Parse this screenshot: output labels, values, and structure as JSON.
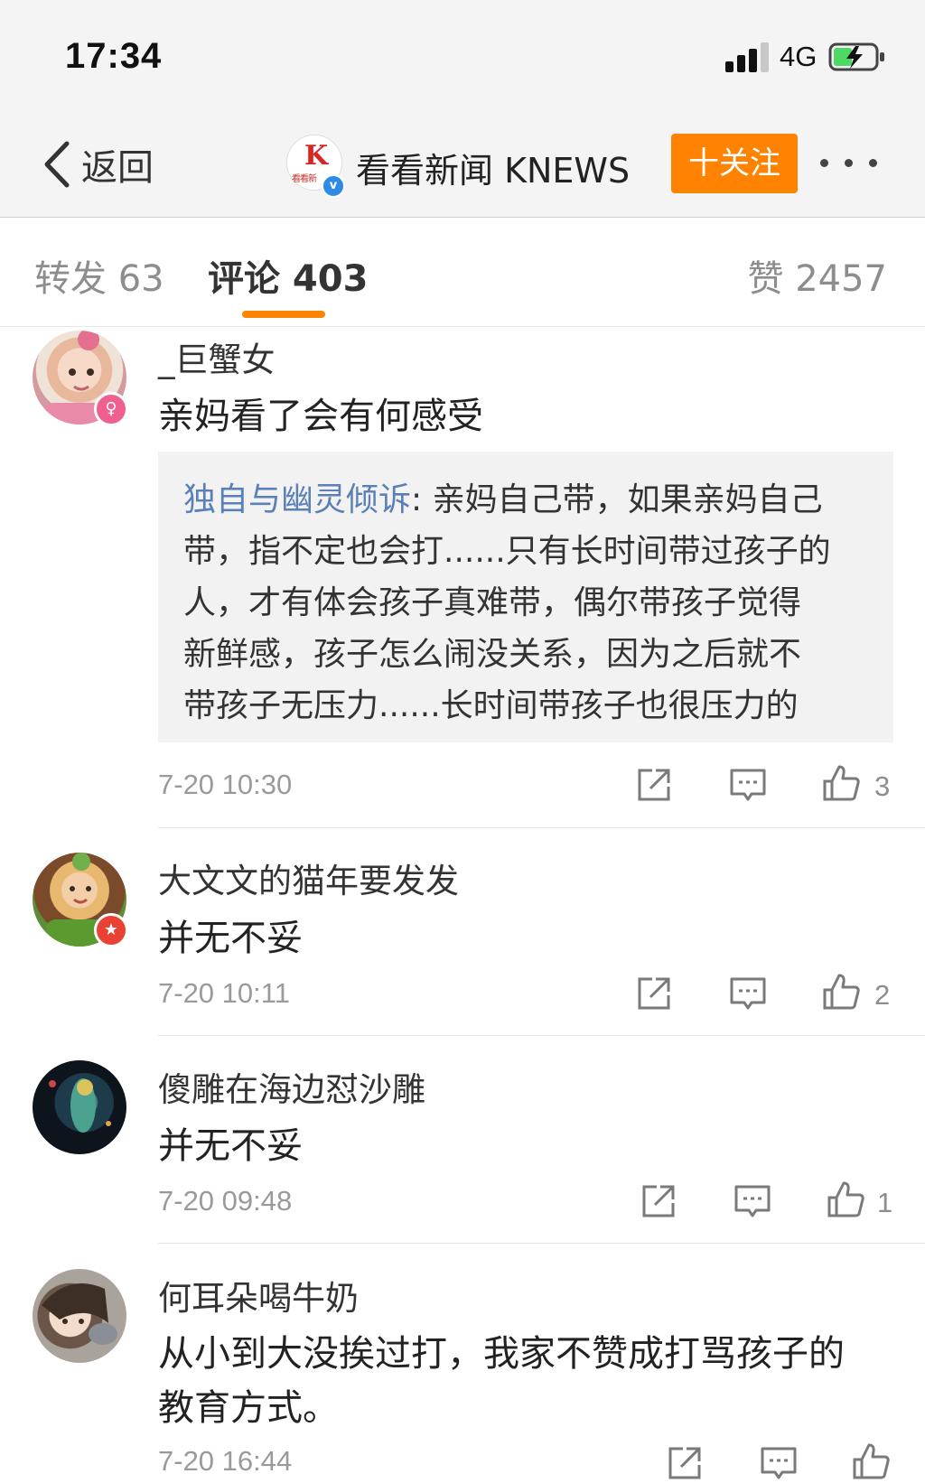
{
  "status": {
    "time": "17:34",
    "network": "4G"
  },
  "header": {
    "back_label": "返回",
    "account_name": "看看新闻 KNEWS",
    "logo_letter": "K",
    "logo_sub": "看看新",
    "verified_mark": "v",
    "follow_label": "十关注"
  },
  "tabs": {
    "repost": "转发 63",
    "comment": "评论 403",
    "like": "赞 2457"
  },
  "comments": [
    {
      "user": "_巨蟹女",
      "lines": [
        "亲妈看了会有何感受"
      ],
      "reply": {
        "user": "独自与幽灵倾诉",
        "lines": [
          ": 亲妈自己带，如果亲妈自己",
          "带，指不定也会打......只有长时间带过孩子的",
          "人，才有体会孩子真难带，偶尔带孩子觉得",
          "新鲜感，孩子怎么闹没关系，因为之后就不",
          "带孩子无压力......长时间带孩子也很压力的"
        ]
      },
      "time": "7-20 10:30",
      "likes": "3"
    },
    {
      "user": "大文文的猫年要发发",
      "lines": [
        "并无不妥"
      ],
      "time": "7-20 10:11",
      "likes": "2"
    },
    {
      "user": "傻雕在海边怼沙雕",
      "lines": [
        "并无不妥"
      ],
      "time": "7-20 09:48",
      "likes": "1"
    },
    {
      "user": "何耳朵喝牛奶",
      "lines": [
        "从小到大没挨过打，我家不赞成打骂孩子的",
        "教育方式。"
      ],
      "time": "7-20 16:44",
      "likes": ""
    }
  ]
}
